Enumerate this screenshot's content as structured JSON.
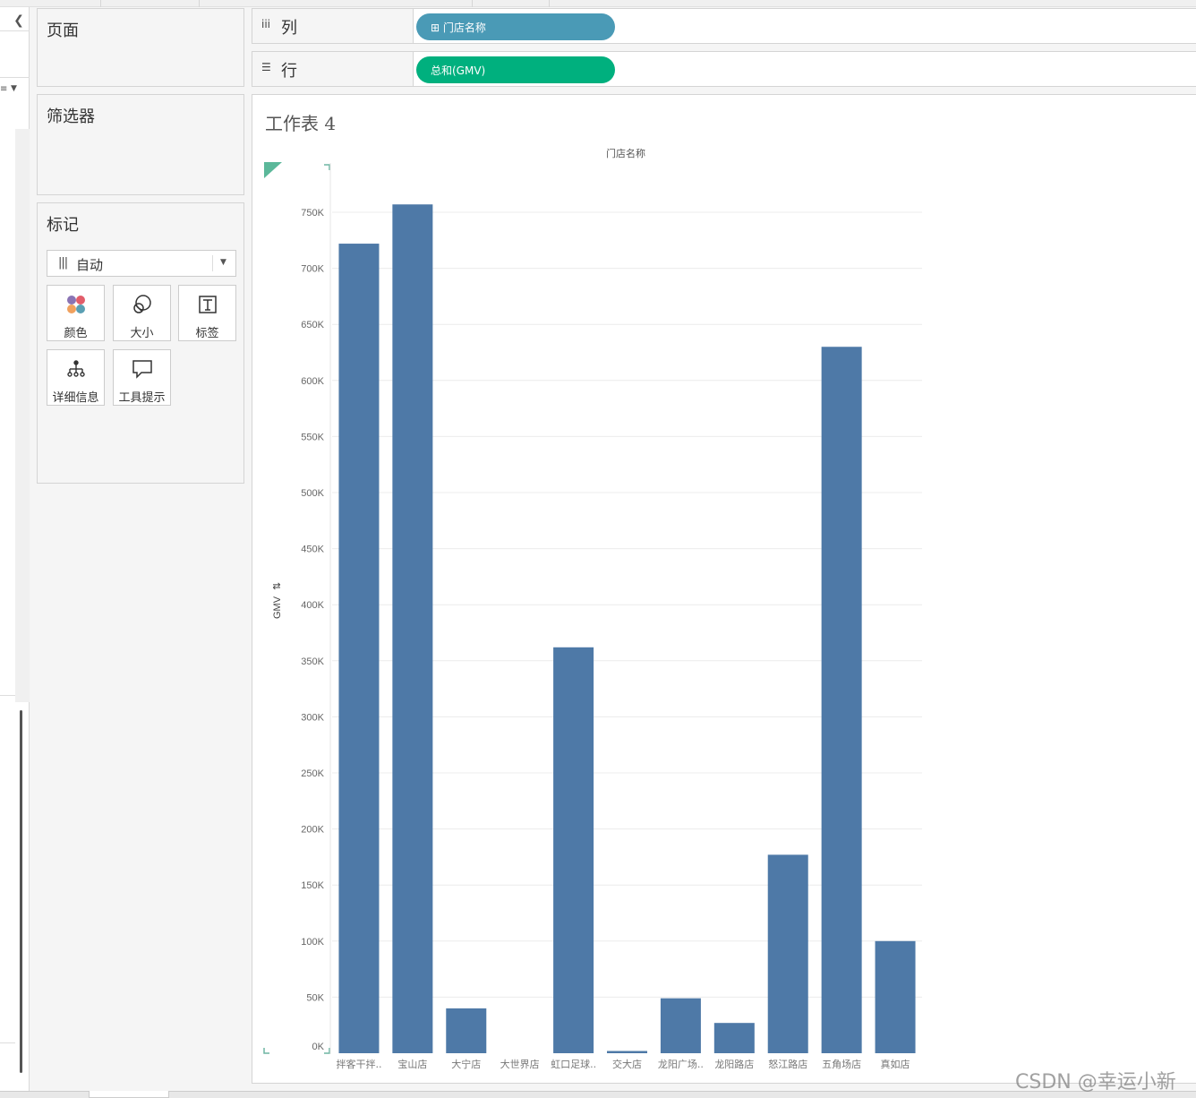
{
  "panels": {
    "pages_title": "页面",
    "filters_title": "筛选器",
    "marks_title": "标记",
    "mark_type": "自动",
    "mark_buttons": [
      {
        "label": "颜色",
        "icon": "color-dots-icon"
      },
      {
        "label": "大小",
        "icon": "size-circles-icon"
      },
      {
        "label": "标签",
        "icon": "text-label-icon"
      },
      {
        "label": "详细信息",
        "icon": "detail-tree-icon"
      },
      {
        "label": "工具提示",
        "icon": "tooltip-bubble-icon"
      }
    ]
  },
  "shelves": {
    "columns_label": "列",
    "columns_pill": "门店名称",
    "rows_label": "行",
    "rows_pill": "总和(GMV)"
  },
  "sheet": {
    "title": "工作表 4"
  },
  "colors": {
    "bar": "#4e79a7",
    "columns_pill": "#4a9ab6",
    "rows_pill": "#00b07e"
  },
  "chart_data": {
    "type": "bar",
    "title": "门店名称",
    "xlabel": "",
    "ylabel": "GMV",
    "ylim": [
      0,
      775000
    ],
    "y_ticks": [
      0,
      50000,
      100000,
      150000,
      200000,
      250000,
      300000,
      350000,
      400000,
      450000,
      500000,
      550000,
      600000,
      650000,
      700000,
      750000
    ],
    "y_tick_labels": [
      "0K",
      "50K",
      "100K",
      "150K",
      "200K",
      "250K",
      "300K",
      "350K",
      "400K",
      "450K",
      "500K",
      "550K",
      "600K",
      "650K",
      "700K",
      "750K"
    ],
    "categories": [
      "拌客干拌..",
      "宝山店",
      "大宁店",
      "大世界店",
      "虹口足球..",
      "交大店",
      "龙阳广场..",
      "龙阳路店",
      "怒江路店",
      "五角场店",
      "真如店"
    ],
    "values": [
      722000,
      757000,
      40000,
      0,
      362000,
      2000,
      49000,
      27000,
      177000,
      630000,
      100000
    ],
    "grid": true
  },
  "watermark": "CSDN @幸运小新"
}
